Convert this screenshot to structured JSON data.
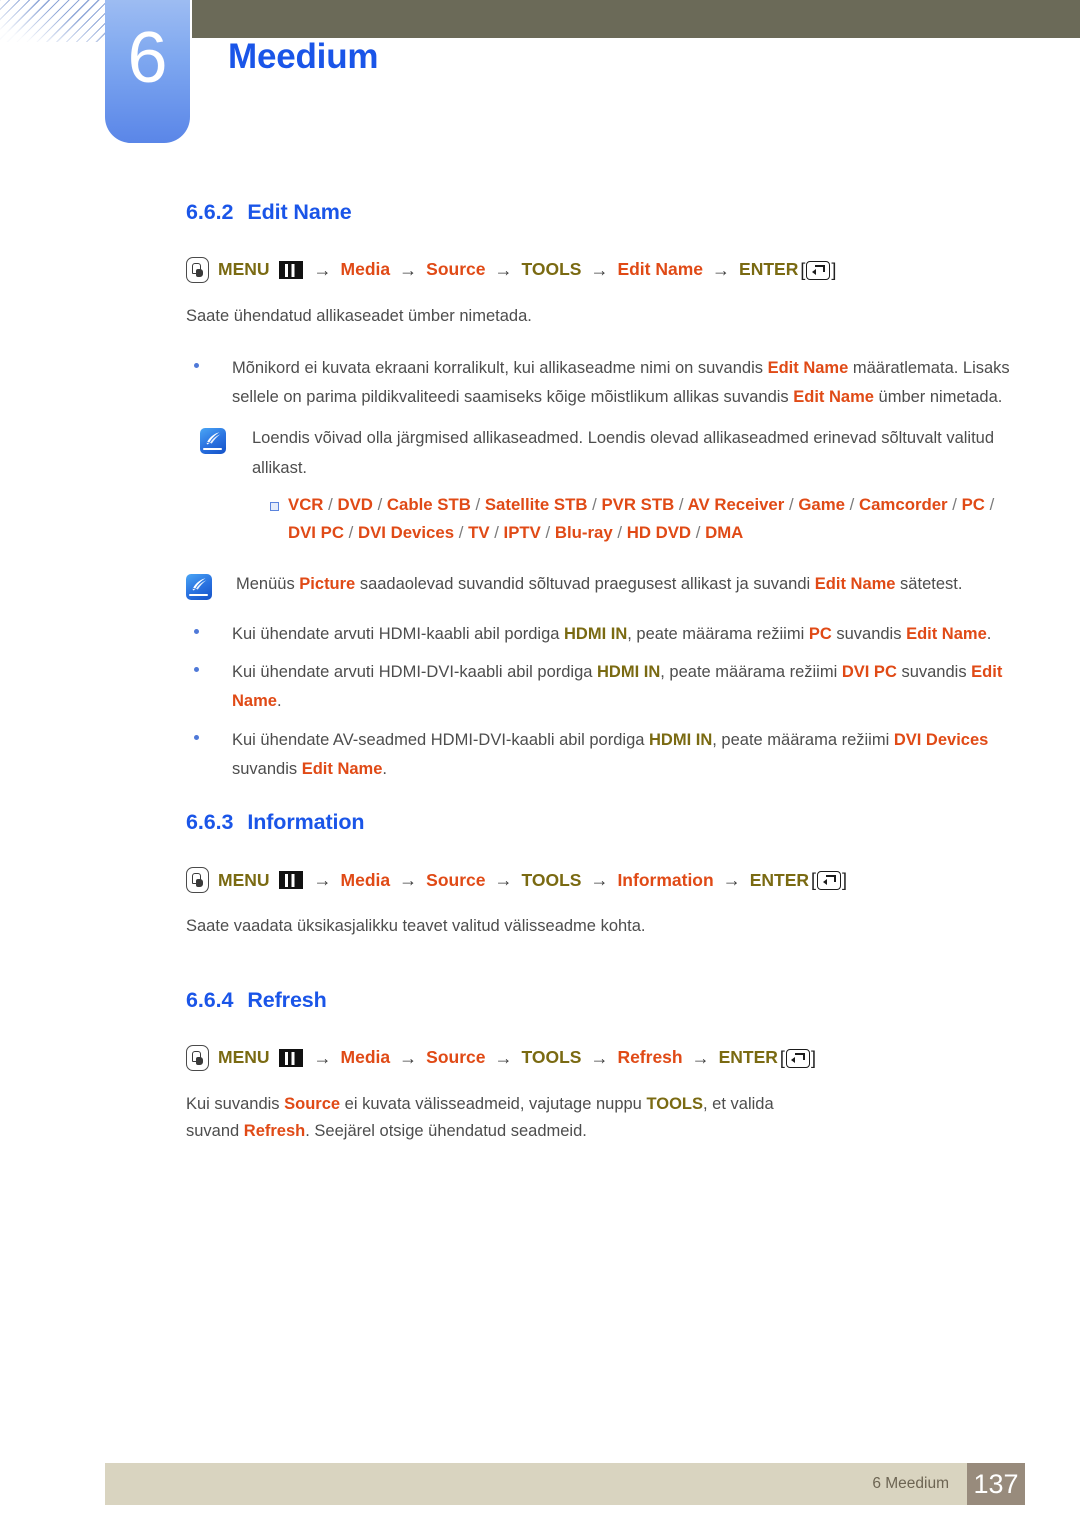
{
  "header": {
    "chapter_number": "6",
    "chapter_title": "Meedium",
    "accent_blue": "#1a55e8",
    "olive_bar": "#6b6a58",
    "tab_gradient_from": "#9dbcf2",
    "tab_gradient_to": "#5a86e8"
  },
  "sections": [
    {
      "number": "6.6.2",
      "title": "Edit Name",
      "menu_path": {
        "hand_icon": "hand-pointer-icon",
        "menu_label": "MENU",
        "menu_icon": "menu-grid-icon",
        "steps": [
          "Media",
          "Source",
          "TOOLS",
          "Edit Name"
        ],
        "enter_label": "ENTER",
        "enter_icon": "enter-key-icon",
        "arrow": "→",
        "bracket_open": "[",
        "bracket_close": "]"
      },
      "intro": "Saate ühendatud allikaseadet ümber nimetada."
    },
    {
      "number": "6.6.3",
      "title": "Information",
      "menu_path": {
        "menu_label": "MENU",
        "steps": [
          "Media",
          "Source",
          "TOOLS",
          "Information"
        ],
        "enter_label": "ENTER"
      },
      "intro": "Saate vaadata üksikasjalikku teavet valitud välisseadme kohta."
    },
    {
      "number": "6.6.4",
      "title": "Refresh",
      "menu_path": {
        "menu_label": "MENU",
        "steps": [
          "Media",
          "Source",
          "TOOLS",
          "Refresh"
        ],
        "enter_label": "ENTER"
      }
    }
  ],
  "bullet1": {
    "part1": "Mõnikord ei kuvata ekraani korralikult, kui allikaseadme nimi on suvandis ",
    "em1": "Edit Name",
    "part2": " määratlemata. Lisaks sellele on parima pildikvaliteedi saamiseks kõige mõistlikum allikas suvandis ",
    "em2": "Edit Name",
    "part3": " ümber nimetada."
  },
  "note1": {
    "icon": "note-pen-icon",
    "text": "Loendis võivad olla järgmised allikaseadmed. Loendis olevad allikaseadmed erinevad sõltuvalt valitud allikast."
  },
  "device_list": {
    "bullet_icon": "square-bullet-icon",
    "line1": [
      "VCR",
      "DVD",
      "Cable STB",
      "Satellite STB",
      "PVR STB",
      "AV Receiver",
      "Game",
      "Camcorder"
    ],
    "line2": [
      "PC",
      "DVI PC",
      "DVI Devices",
      "TV",
      "IPTV",
      "Blu-ray",
      "HD DVD",
      "DMA"
    ],
    "separator": "/"
  },
  "note2": {
    "icon": "note-pen-icon",
    "part1": "Menüüs ",
    "em1": "Picture",
    "part2": " saadaolevad suvandid sõltuvad praegusest allikast ja suvandi ",
    "em2": "Edit Name",
    "part3": " sätetest."
  },
  "hdmi_bullets": [
    {
      "part1": "Kui ühendate arvuti HDMI-kaabli abil pordiga ",
      "em1": "HDMI IN",
      "em1_color": "olive",
      "part2": ", peate määrama režiimi ",
      "em2": "PC",
      "part3": " suvandis ",
      "em3": "Edit Name",
      "part4": "."
    },
    {
      "part1": "Kui ühendate arvuti HDMI-DVI-kaabli abil pordiga ",
      "em1": "HDMI IN",
      "em1_color": "olive",
      "part2": ", peate määrama režiimi ",
      "em2": "DVI PC",
      "part3": " suvandis ",
      "em3": "Edit Name",
      "part4": "."
    },
    {
      "part1": "Kui ühendate AV-seadmed HDMI-DVI-kaabli abil pordiga ",
      "em1": "HDMI IN",
      "em1_color": "olive",
      "part2": ", peate määrama režiimi ",
      "em2": "DVI Devices",
      "part3": " suvandis ",
      "em3": "Edit Name",
      "part4": "."
    }
  ],
  "refresh_body": {
    "part1": "Kui suvandis ",
    "em1": "Source",
    "part2": " ei kuvata välisseadmeid, vajutage nuppu ",
    "em2": "TOOLS",
    "part3": ", et valida suvand ",
    "em3": "Refresh",
    "part4": ". Seejärel otsige ühendatud seadmeid."
  },
  "footer": {
    "label": "6 Meedium",
    "page": "137",
    "bar_color": "#d9d4c0",
    "page_box_color": "#988b7c"
  }
}
